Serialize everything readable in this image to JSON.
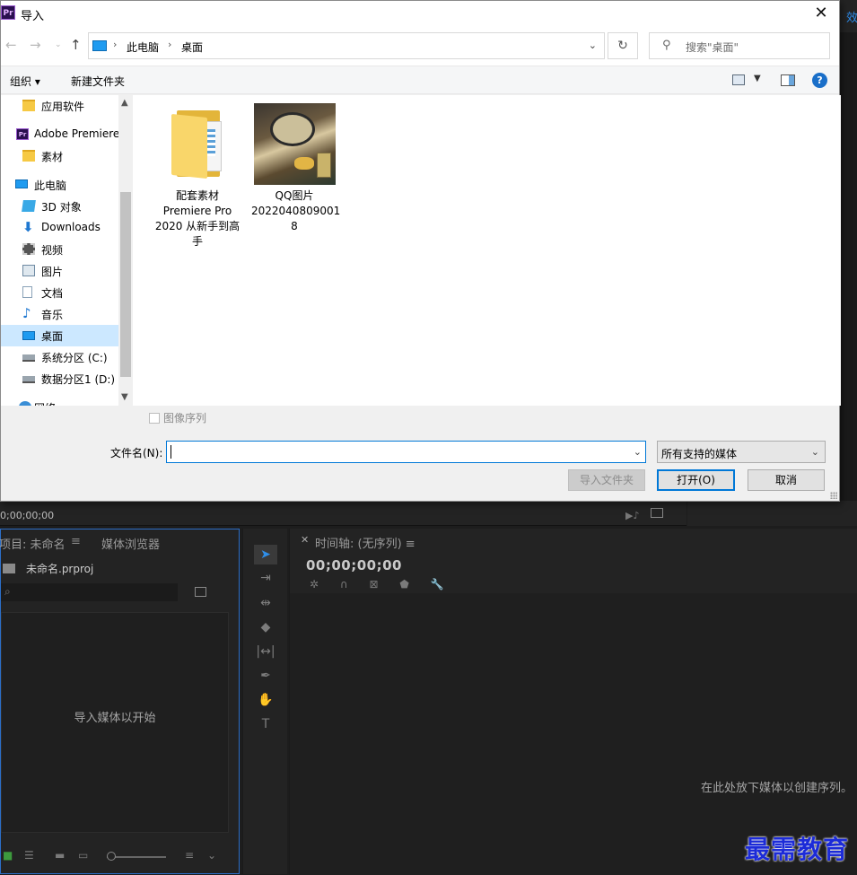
{
  "dialog": {
    "title": "导入",
    "logo_text": "Pr",
    "close_glyph": "✕"
  },
  "address_bar": {
    "breadcrumbs": [
      "此电脑",
      "桌面"
    ],
    "search_placeholder": "搜索\"桌面\""
  },
  "toolbar": {
    "organize_label": "组织 ▾",
    "new_folder_label": "新建文件夹",
    "help_glyph": "?"
  },
  "nav_pane": {
    "items": [
      {
        "label": "应用软件",
        "icon": "folder-icon"
      },
      {
        "label": "Adobe Premiere",
        "icon": "premiere-icon"
      },
      {
        "label": "素材",
        "icon": "folder-icon"
      },
      {
        "label": "此电脑",
        "icon": "computer-icon"
      },
      {
        "label": "3D 对象",
        "icon": "3d-objects-icon"
      },
      {
        "label": "Downloads",
        "icon": "download-icon"
      },
      {
        "label": "视频",
        "icon": "video-icon"
      },
      {
        "label": "图片",
        "icon": "pictures-icon"
      },
      {
        "label": "文档",
        "icon": "documents-icon"
      },
      {
        "label": "音乐",
        "icon": "music-icon"
      },
      {
        "label": "桌面",
        "icon": "desktop-icon",
        "selected": true
      },
      {
        "label": "系统分区 (C:)",
        "icon": "drive-icon"
      },
      {
        "label": "数据分区1 (D:)",
        "icon": "drive-icon"
      },
      {
        "label": "网络",
        "icon": "network-icon"
      }
    ]
  },
  "files": [
    {
      "type": "folder",
      "label_lines": [
        "配套素材",
        "Premiere Pro",
        "2020 从新手到高",
        "手"
      ]
    },
    {
      "type": "image",
      "label_lines": [
        "QQ图片",
        "2022040809001",
        "8"
      ]
    }
  ],
  "options": {
    "image_sequence_label": "图像序列",
    "image_sequence_checked": false
  },
  "bottom": {
    "filename_label": "文件名(N):",
    "filename_value": "",
    "file_type_value": "所有支持的媒体",
    "import_folder_label": "导入文件夹",
    "open_label": "打开(O)",
    "cancel_label": "取消"
  },
  "premiere": {
    "top_right_text": "效",
    "timecode": "0;00;00;00",
    "project_tab": "项目: 未命名",
    "media_browser_tab": "媒体浏览器",
    "project_file": "未命名.prproj",
    "project_hint": "导入媒体以开始",
    "timeline_title": "时间轴: (无序列)",
    "timeline_timecode": "00;00;00;00",
    "timeline_hint": "在此处放下媒体以创建序列。",
    "panel_menu_glyph": "≡"
  },
  "watermark": "最需教育",
  "colors": {
    "accent_blue": "#0078d7",
    "premiere_blue": "#2f8ee8",
    "selection": "#cce8ff",
    "watermark": "#1c2bd8"
  }
}
